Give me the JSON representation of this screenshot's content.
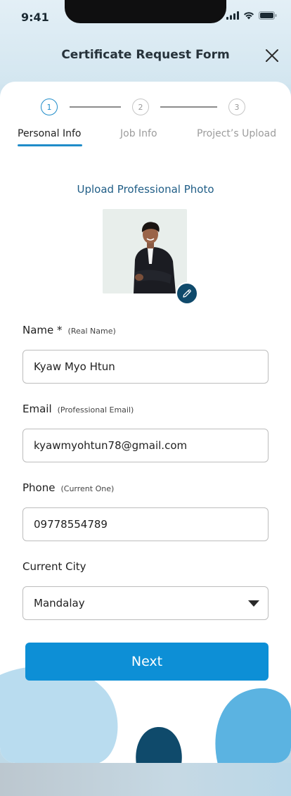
{
  "status_bar": {
    "time": "9:41"
  },
  "header": {
    "title": "Certificate Request Form"
  },
  "stepper": {
    "steps": [
      {
        "number": "1",
        "label": "Personal Info"
      },
      {
        "number": "2",
        "label": "Job Info"
      },
      {
        "number": "3",
        "label": "Project’s Upload"
      }
    ],
    "active_step": 1
  },
  "photo_section": {
    "title": "Upload Professional Photo"
  },
  "form": {
    "name": {
      "label": "Name *",
      "hint": "(Real Name)",
      "value": "Kyaw Myo Htun"
    },
    "email": {
      "label": "Email",
      "hint": "(Professional Email)",
      "value": "kyawmyohtun78@gmail.com"
    },
    "phone": {
      "label": "Phone",
      "hint": "(Current One)",
      "value": "09778554789"
    },
    "city": {
      "label": "Current City",
      "selected": "Mandalay"
    }
  },
  "actions": {
    "next_label": "Next"
  },
  "colors": {
    "primary": "#0d8fd6",
    "accent_dark": "#0f4a6b",
    "title_blue": "#1f5d86"
  }
}
